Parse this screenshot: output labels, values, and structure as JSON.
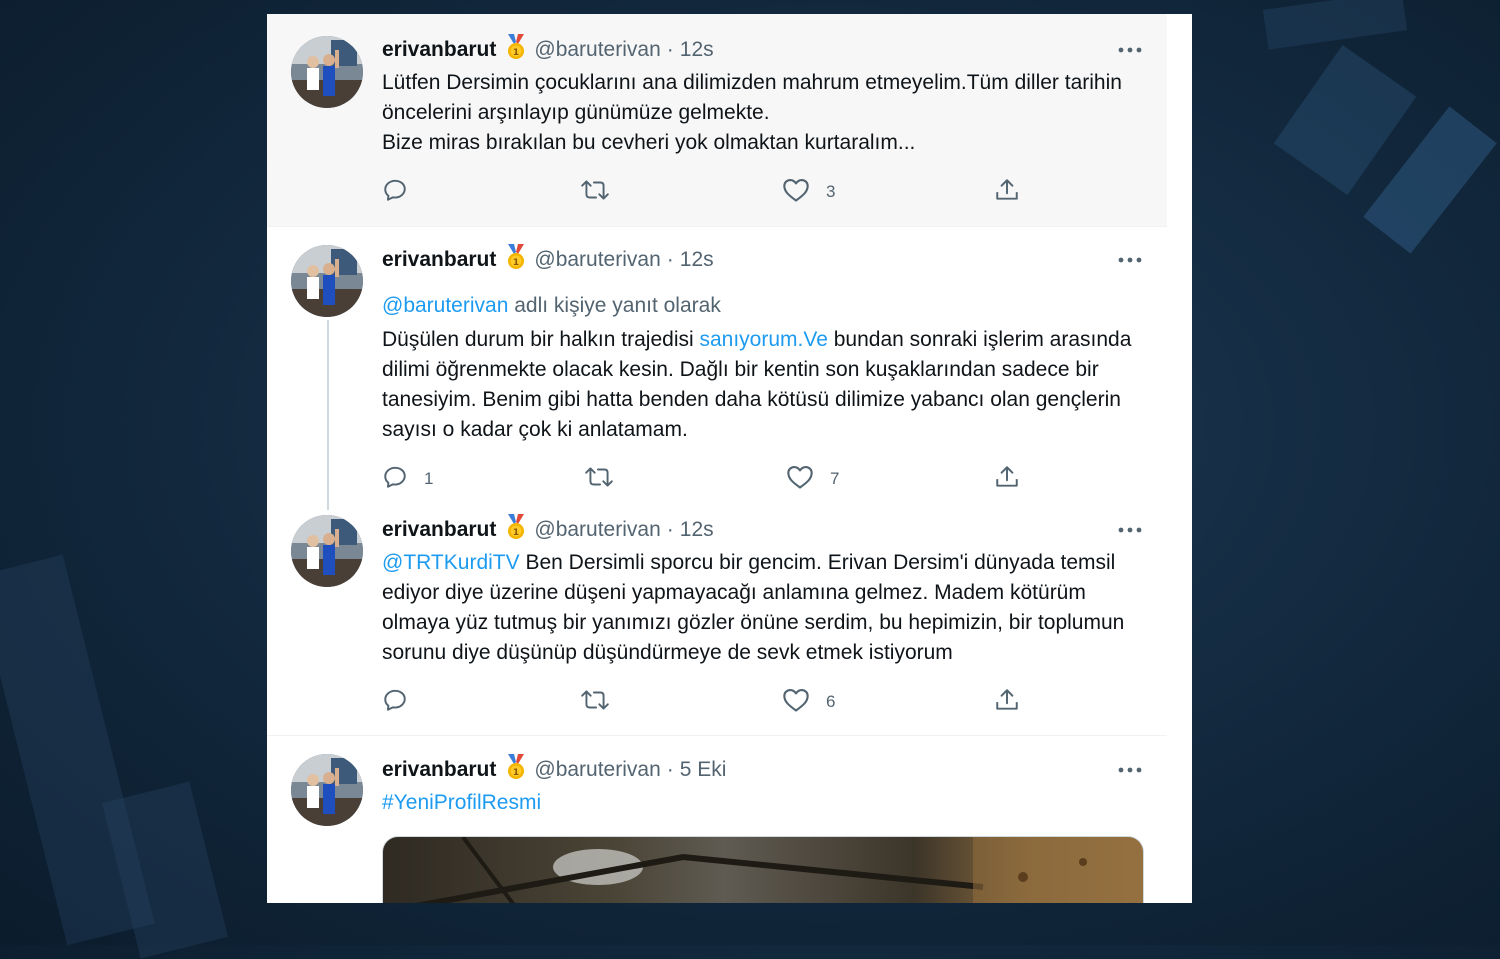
{
  "profile": {
    "display_name": "erivanbarut",
    "handle": "@baruterivan"
  },
  "tweets": [
    {
      "time": "12s",
      "text": "Lütfen Dersimin çocuklarını ana dilimizden mahrum etmeyelim.Tüm diller tarihin öncelerini arşınlayıp günümüze gelmekte.\nBize miras bırakılan bu  cevheri yok olmaktan kurtaralım...",
      "reply_count": "",
      "retweet_count": "",
      "like_count": "3"
    },
    {
      "time": "12s",
      "reply_prefix": "@baruterivan",
      "reply_suffix": " adlı kişiye yanıt olarak",
      "text_before": "Düşülen durum bir halkın trajedisi ",
      "text_link": "sanıyorum.Ve",
      "text_after": " bundan sonraki işlerim arasında dilimi öğrenmekte olacak kesin. Dağlı bir kentin son kuşaklarından sadece bir tanesiyim. Benim gibi hatta benden daha kötüsü dilimize yabancı olan gençlerin sayısı o kadar çok ki anlatamam.",
      "reply_count": "1",
      "retweet_count": "",
      "like_count": "7"
    },
    {
      "time": "12s",
      "mention": "@TRTKurdiTV",
      "text": " Ben Dersimli sporcu bir gencim. Erivan Dersim'i dünyada temsil ediyor diye üzerine düşeni yapmayacağı anlamına gelmez. Madem kötürüm olmaya yüz tutmuş bir yanımızı gözler önüne serdim, bu hepimizin, bir toplumun sorunu diye düşünüp düşündürmeye de sevk etmek istiyorum",
      "reply_count": "",
      "retweet_count": "",
      "like_count": "6"
    },
    {
      "time": "5 Eki",
      "hashtag": "#YeniProfilResmi"
    }
  ],
  "header_separator": "·",
  "icons": {
    "more": "more-horizontal-icon",
    "reply": "reply-icon",
    "retweet": "retweet-icon",
    "like": "heart-icon",
    "share": "share-icon",
    "verified_emoji": "gold-medal-icon"
  },
  "colors": {
    "link": "#1d9bf0",
    "text": "#0f1419",
    "muted": "#536471",
    "highlight_bg": "#f7f7f7"
  }
}
